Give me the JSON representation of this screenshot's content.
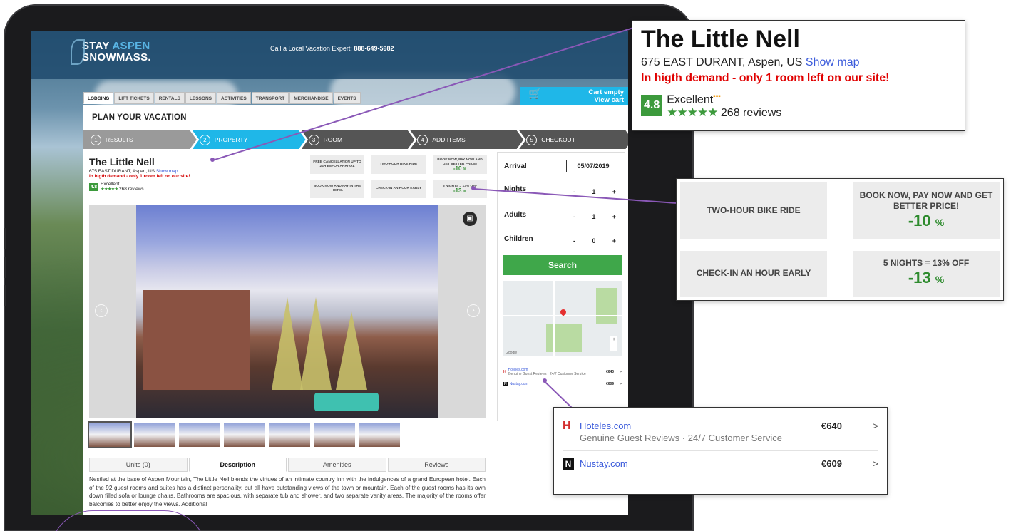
{
  "header": {
    "logo_line1_a": "STAY",
    "logo_line1_b": "ASPEN",
    "logo_line2": "SNOWMASS.",
    "phone_label": "Call a Local Vacation Expert:",
    "phone_number": "888-649-5982"
  },
  "nav": {
    "tabs": [
      "LODGING",
      "LIFT TICKETS",
      "RENTALS",
      "LESSONS",
      "ACTIVITIES",
      "TRANSPORT",
      "MERCHANDISE",
      "EVENTS"
    ],
    "active": "LODGING"
  },
  "cart": {
    "line1": "Cart empty",
    "line2": "View cart",
    "icon": "cart-icon"
  },
  "page_title": "PLAN YOUR VACATION",
  "steps": [
    {
      "num": "1",
      "label": "RESULTS"
    },
    {
      "num": "2",
      "label": "PROPERTY"
    },
    {
      "num": "3",
      "label": "ROOM"
    },
    {
      "num": "4",
      "label": "ADD ITEMS"
    },
    {
      "num": "5",
      "label": "CHECKOUT"
    }
  ],
  "hotel": {
    "name": "The Little Nell",
    "address_small": "675 EAST DURANT, Aspen, US",
    "address_large": "675 EAST DURANT, Aspen, US",
    "show_map": "Show map",
    "demand": "In higth demand - only 1 room left on our site!",
    "score": "4.8",
    "rating_label": "Excellent",
    "stars": "★★★★★",
    "reviews": "268 reviews"
  },
  "perks": {
    "free_cancel": "FREE CANCELLATION UP TO 24H BEFOR ARRIVAL",
    "bike": "TWO-HOUR BIKE RIDE",
    "book_now_small": "BOOK NOW, PAY NOW AND GET BETTER PRICE!",
    "book_now": "BOOK NOW, PAY NOW AND GET BETTER PRICE!",
    "book_pct": "-10",
    "pay_hotel": "BOOK NOW AND PAY IN THE HOTEL",
    "checkin": "CHECK-IN AN HOUR EARLY",
    "nights_deal_small": "5 NIGHTS = 13% OFF",
    "nights_deal": "5 NIGHTS = 13% OFF",
    "nights_pct": "-13",
    "pct_symbol": "%"
  },
  "description_tabs": [
    "Units (0)",
    "Description",
    "Amenities",
    "Reviews"
  ],
  "description_text": "Nestled at the base of Aspen Mountain, The Little Nell blends the virtues of an intimate country inn with the indulgences of a grand European hotel. Each of the 92 guest rooms and suites has a distinct personality, but all have outstanding views of the town or mountain. Each of the guest rooms has its own down filled sofa or lounge chairs. Bathrooms are spacious, with separate tub and shower, and two separate vanity areas. The majority of the rooms offer balconies to better enjoy the views. Additional",
  "booking": {
    "arrival_label": "Arrival",
    "arrival_value": "05/07/2019",
    "nights_label": "Nights",
    "nights_value": "1",
    "adults_label": "Adults",
    "adults_value": "1",
    "children_label": "Children",
    "children_value": "0",
    "minus": "-",
    "plus": "+",
    "search_label": "Search"
  },
  "offers": [
    {
      "logo": "H",
      "name": "Hoteles.com",
      "sub": "Genuine Guest Reviews · 24/7 Customer Service",
      "price": "€640",
      "chevron": ">"
    },
    {
      "logo": "N",
      "name": "Nustay.com",
      "sub": "",
      "price": "€609",
      "chevron": ">"
    }
  ],
  "map": {
    "attribution": "Google"
  },
  "colors": {
    "accent": "#1fb7e8",
    "green": "#3fa74a",
    "demand_red": "#e00000",
    "callout_line": "#8a58b7"
  }
}
